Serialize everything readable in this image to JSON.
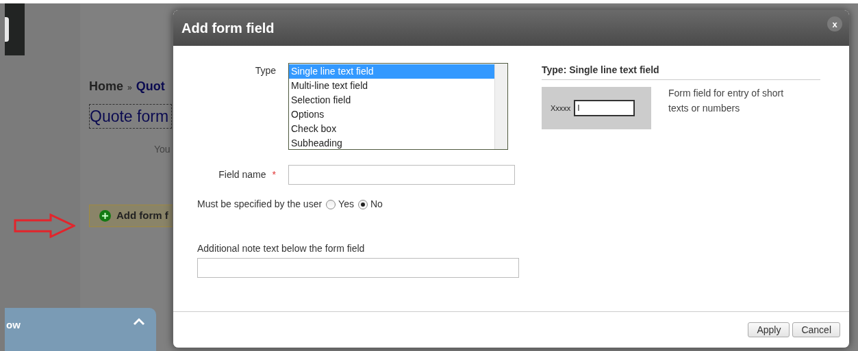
{
  "background": {
    "breadcrumb": {
      "home": "Home",
      "separator": "»",
      "current": "Quot"
    },
    "heading": "Quote form",
    "intro": "You",
    "add_button": "Add form f",
    "bottom_panel": {
      "label": "ow"
    }
  },
  "dialog": {
    "title": "Add form field",
    "close": "x",
    "type_label": "Type",
    "type_options": [
      {
        "label": "Single line text field",
        "selected": true
      },
      {
        "label": "Multi-line text field",
        "selected": false
      },
      {
        "label": "Selection field",
        "selected": false
      },
      {
        "label": "Options",
        "selected": false
      },
      {
        "label": "Check box",
        "selected": false
      },
      {
        "label": "Subheading",
        "selected": false
      }
    ],
    "field_name_label": "Field name",
    "required_mark": "*",
    "required_question": "Must be specified by the user",
    "required_options": [
      {
        "label": "Yes",
        "selected": false
      },
      {
        "label": "No",
        "selected": true
      }
    ],
    "note_label": "Additional note text below the form field",
    "preview": {
      "heading": "Type: Single line text field",
      "sample_label": "Xxxxx",
      "sample_value": "I",
      "description": "Form field for entry of short texts or numbers"
    },
    "buttons": [
      "Apply",
      "Cancel"
    ]
  }
}
